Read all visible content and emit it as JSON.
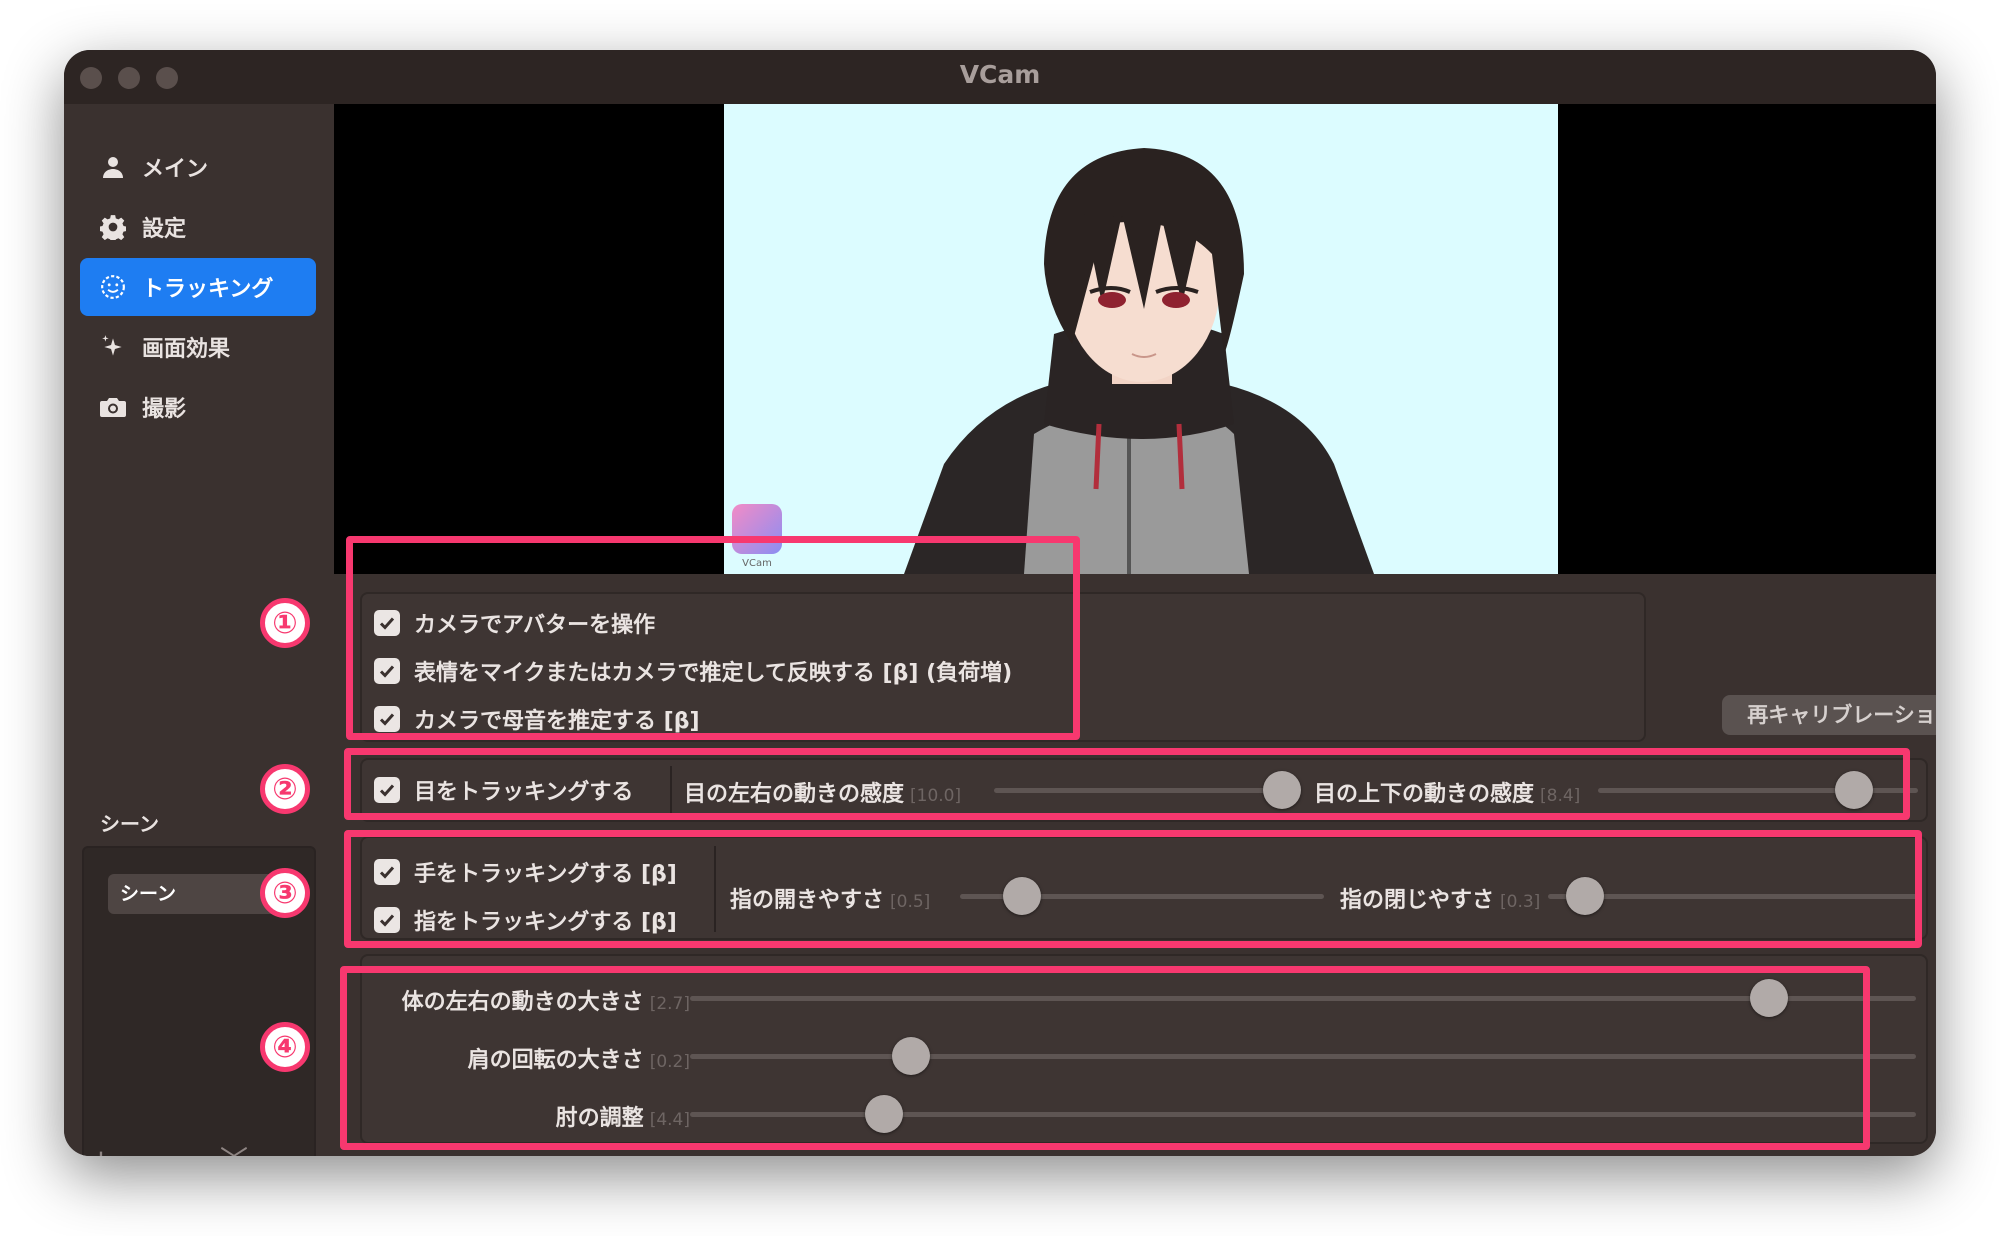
{
  "window": {
    "title": "VCam"
  },
  "sidebar": {
    "items": [
      {
        "label": "メイン",
        "icon": "person-icon",
        "active": false
      },
      {
        "label": "設定",
        "icon": "gear-icon",
        "active": false
      },
      {
        "label": "トラッキング",
        "icon": "smiley-icon",
        "active": true
      },
      {
        "label": "画面効果",
        "icon": "sparkle-icon",
        "active": false
      },
      {
        "label": "撮影",
        "icon": "camera-icon",
        "active": false
      }
    ],
    "scene_title": "シーン",
    "scenes": [
      "シーン"
    ],
    "scene_toolbar": [
      "+",
      "—",
      "︿",
      "﹀"
    ]
  },
  "preview": {
    "badge_text": "VCam"
  },
  "tracking": {
    "camera_options": [
      {
        "label": "カメラでアバターを操作",
        "checked": true
      },
      {
        "label": "表情をマイクまたはカメラで推定して反映する [β] (負荷増)",
        "checked": true
      },
      {
        "label": "カメラで母音を推定する [β]",
        "checked": true
      }
    ],
    "recalibrate_label": "再キャリブレーション",
    "eye": {
      "label": "目をトラッキングする",
      "checked": true,
      "sliders": [
        {
          "label": "目の左右の動きの感度",
          "value_text": "[10.0]",
          "fraction": 0.96
        },
        {
          "label": "目の上下の動きの感度",
          "value_text": "[8.4]",
          "fraction": 0.8
        }
      ]
    },
    "hand": {
      "options": [
        {
          "label": "手をトラッキングする [β]",
          "checked": true
        },
        {
          "label": "指をトラッキングする [β]",
          "checked": true
        }
      ],
      "sliders": [
        {
          "label": "指の開きやすさ",
          "value_text": "[0.5]",
          "fraction": 0.17
        },
        {
          "label": "指の閉じやすさ",
          "value_text": "[0.3]",
          "fraction": 0.1
        }
      ]
    },
    "body": {
      "sliders": [
        {
          "label": "体の左右の動きの大きさ",
          "value_text": "[2.7]",
          "fraction": 0.88
        },
        {
          "label": "肩の回転の大きさ",
          "value_text": "[0.2]",
          "fraction": 0.18
        },
        {
          "label": "肘の調整",
          "value_text": "[4.4]",
          "fraction": 0.158
        }
      ]
    }
  },
  "annotations": [
    "①",
    "②",
    "③",
    "④"
  ],
  "colors": {
    "accent": "#1e7df2",
    "highlight": "#f7386f",
    "window_bg": "#362d2b",
    "preview_bg": "#dcfcff"
  }
}
